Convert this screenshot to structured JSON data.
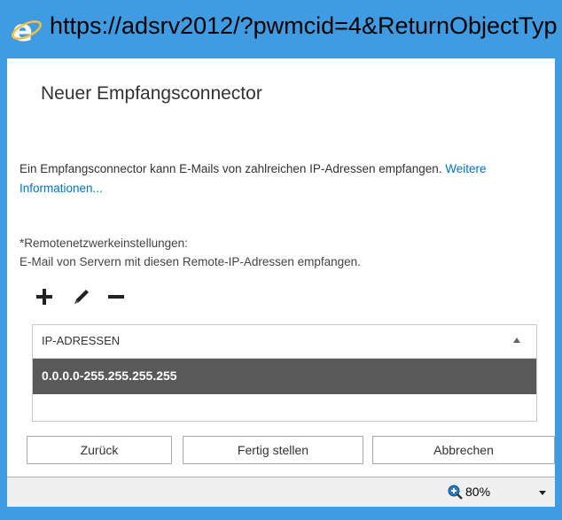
{
  "window": {
    "url": "https://adsrv2012/?pwmcid=4&ReturnObjectTyp",
    "accent_color": "#3f9be2",
    "icon": "ie-icon"
  },
  "dialog": {
    "title": "Neuer Empfangsconnector",
    "intro_text": "Ein Empfangsconnector kann E-Mails von zahlreichen IP-Adressen empfangen. ",
    "intro_link": "Weitere Informationen...",
    "network_label": "*Remotenetzwerkeinstellungen:",
    "network_desc": "E-Mail von Servern mit diesen Remote-IP-Adressen empfangen."
  },
  "toolbar": {
    "add_icon": "plus-icon",
    "edit_icon": "pencil-icon",
    "remove_icon": "minus-icon"
  },
  "grid": {
    "header": "IP-ADRESSEN",
    "rows": [
      "0.0.0.0-255.255.255.255"
    ],
    "selected_row_color": "#595959"
  },
  "buttons": {
    "back": "Zurück",
    "finish": "Fertig stellen",
    "cancel": "Abbrechen"
  },
  "statusbar": {
    "zoom": "80%",
    "zoom_icon": "zoom-icon"
  }
}
